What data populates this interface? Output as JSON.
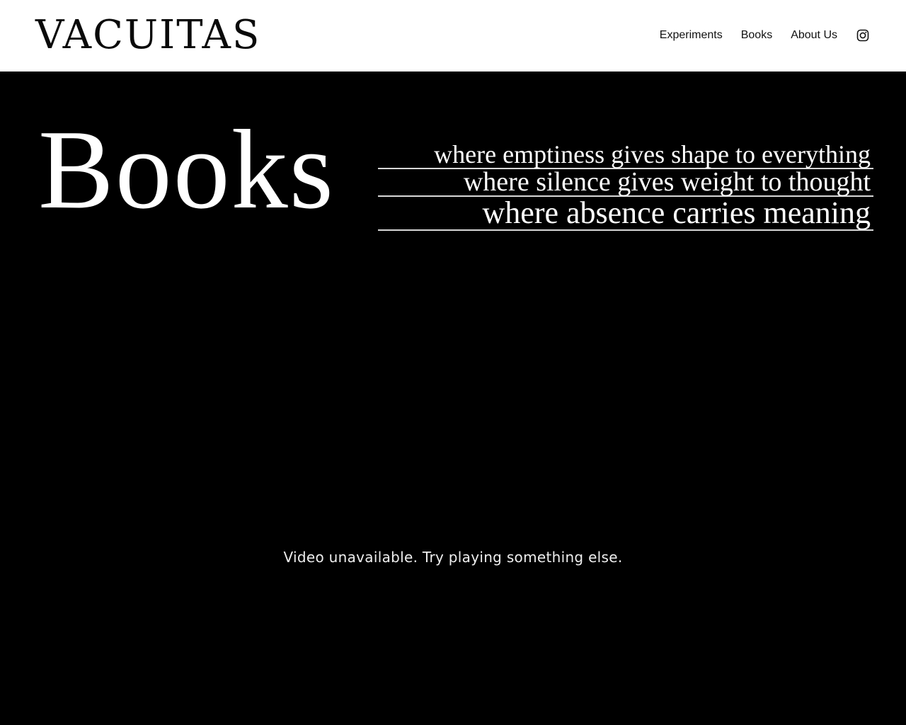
{
  "header": {
    "logo_text": "VACUITAS",
    "nav": {
      "items": [
        {
          "label": "Experiments"
        },
        {
          "label": "Books"
        },
        {
          "label": "About Us"
        }
      ],
      "social_icon": "instagram-icon"
    }
  },
  "hero": {
    "title": "Books",
    "taglines": [
      "where emptiness gives shape to everything",
      "where silence gives weight to thought",
      "where absence carries meaning"
    ]
  },
  "video": {
    "message": "Video unavailable. Try playing something else."
  },
  "colors": {
    "header_background": "#ffffff",
    "page_background": "#000000",
    "text_light": "#ffffff",
    "text_dark": "#0a0a0a"
  }
}
